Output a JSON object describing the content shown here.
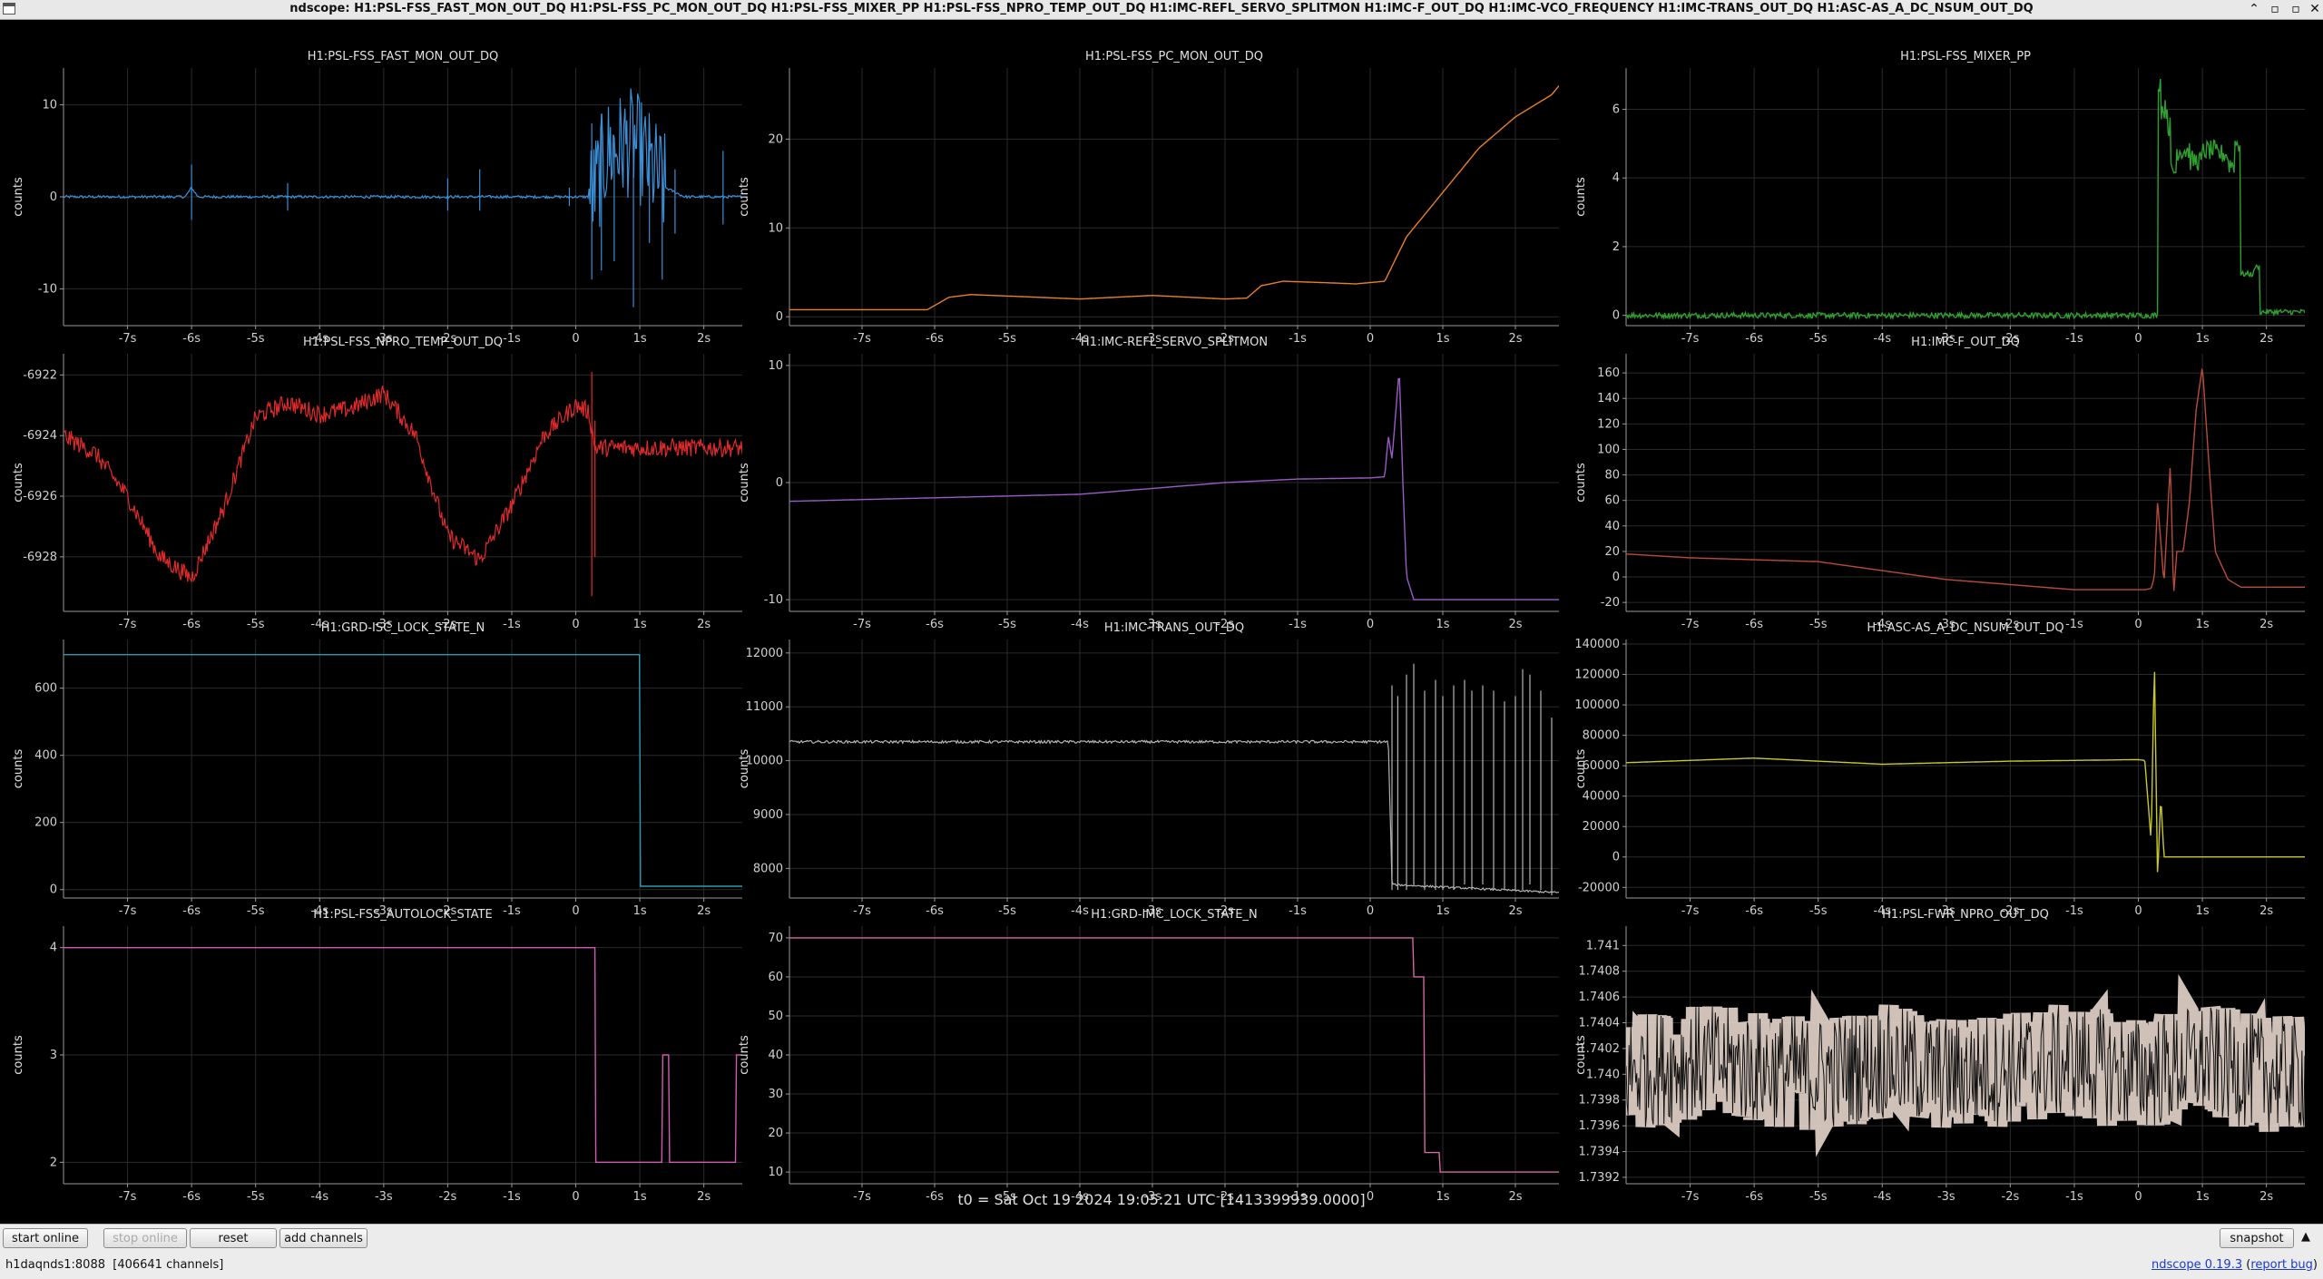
{
  "window": {
    "title": "ndscope: H1:PSL-FSS_FAST_MON_OUT_DQ H1:PSL-FSS_PC_MON_OUT_DQ H1:PSL-FSS_MIXER_PP H1:PSL-FSS_NPRO_TEMP_OUT_DQ H1:IMC-REFL_SERVO_SPLITMON H1:IMC-F_OUT_DQ H1:IMC-VCO_FREQUENCY H1:IMC-TRANS_OUT_DQ H1:ASC-AS_A_DC_NSUM_OUT_DQ",
    "controls": {
      "minimize": "⌃",
      "maximize": "▫",
      "restore": "▫",
      "close": "✕"
    }
  },
  "t0_label": "t0 = Sat Oct 19 2024 19:05:21 UTC [1413399939.0000]",
  "toolbar": {
    "start_online": "start online",
    "stop_online": "stop online",
    "reset": "reset",
    "add_channels": "add channels",
    "snapshot": "snapshot",
    "toggle": "▲"
  },
  "status": {
    "server": "h1daqnds1:8088",
    "channels": "[406641 channels]",
    "version_prefix": "ndscope",
    "version": "0.19.3",
    "report_bug": "report bug"
  },
  "chart_data": [
    {
      "type": "line",
      "title": "H1:PSL-FSS_FAST_MON_OUT_DQ",
      "ylabel": "counts",
      "color": "#3a8fd6",
      "style": "noise",
      "xlim": [
        -8,
        2.6
      ],
      "ylim": [
        -14,
        14
      ],
      "yticks": [
        -10,
        0,
        10
      ],
      "x": [
        -8,
        -6.1,
        -6,
        -5.9,
        -5,
        -3,
        -1,
        0,
        0.2,
        0.3,
        0.5,
        0.9,
        1.2,
        1.4,
        1.7,
        2.6
      ],
      "y": [
        0,
        0,
        1,
        0,
        0,
        0,
        0,
        0,
        0,
        1,
        5,
        6,
        3,
        1,
        0,
        0
      ],
      "noise": 0.15,
      "noise_x": [
        0.2,
        1.4
      ],
      "noise_y": 6,
      "spikes": [
        [
          -6,
          3.5,
          -2.5
        ],
        [
          -4.5,
          1.5,
          -1.5
        ],
        [
          -2,
          2,
          -1.5
        ],
        [
          -1.5,
          3,
          -1.5
        ],
        [
          -0.1,
          1,
          -1
        ],
        [
          0.25,
          8,
          -9
        ],
        [
          0.4,
          9,
          -8
        ],
        [
          0.6,
          6,
          -7
        ],
        [
          0.9,
          4,
          -12
        ],
        [
          1.15,
          8,
          -5
        ],
        [
          1.35,
          4,
          -9
        ],
        [
          1.55,
          3,
          -4
        ],
        [
          2.3,
          5,
          -3
        ]
      ]
    },
    {
      "type": "line",
      "title": "H1:PSL-FSS_PC_MON_OUT_DQ",
      "ylabel": "counts",
      "color": "#e8802a",
      "style": "line",
      "xlim": [
        -8,
        2.6
      ],
      "ylim": [
        -1,
        28
      ],
      "yticks": [
        0,
        10,
        20
      ],
      "x": [
        -8,
        -6.1,
        -5.8,
        -5.5,
        -4,
        -3,
        -2.5,
        -2,
        -1.7,
        -1.5,
        -1.2,
        -0.5,
        -0.2,
        0.2,
        0.5,
        1,
        1.5,
        2,
        2.5,
        2.6
      ],
      "y": [
        0.8,
        0.8,
        2.2,
        2.5,
        2,
        2.4,
        2.2,
        2.0,
        2.1,
        3.5,
        4,
        3.8,
        3.7,
        4,
        9,
        14,
        19,
        22.5,
        25,
        26
      ],
      "noise": 0
    },
    {
      "type": "line",
      "title": "H1:PSL-FSS_MIXER_PP",
      "ylabel": "counts",
      "color": "#2ea02e",
      "style": "step",
      "xlim": [
        -8,
        2.6
      ],
      "ylim": [
        -0.3,
        7.2
      ],
      "yticks": [
        0,
        2,
        4,
        6
      ],
      "x": [
        -8,
        0.2,
        0.3,
        0.35,
        0.45,
        0.5,
        0.6,
        0.8,
        1.0,
        1.2,
        1.4,
        1.5,
        1.6,
        1.8,
        1.9,
        2.0,
        2.4,
        2.6
      ],
      "y": [
        0,
        0,
        6.8,
        6,
        5.5,
        4.2,
        4.8,
        4.5,
        4.8,
        4.7,
        4.4,
        5,
        1.2,
        1.4,
        0.1,
        0.1,
        0.1,
        1.3
      ],
      "noise": 0.08,
      "noise_x": [
        0.3,
        1.6
      ],
      "noise_y": 0.3
    },
    {
      "type": "line",
      "title": "H1:PSL-FSS_NPRO_TEMP_OUT_DQ",
      "ylabel": "counts",
      "color": "#e02a2a",
      "style": "noise",
      "xlim": [
        -8,
        2.6
      ],
      "ylim": [
        -6929.8,
        -6921.3
      ],
      "yticks": [
        -6928,
        -6926,
        -6924,
        -6922
      ],
      "x": [
        -8,
        -7.5,
        -7,
        -6.5,
        -6,
        -5.5,
        -5,
        -4.5,
        -4,
        -3.5,
        -3,
        -2.5,
        -2,
        -1.5,
        -1,
        -0.5,
        0,
        0.2,
        0.3,
        0.4,
        0.6,
        1,
        2,
        2.6
      ],
      "y": [
        -6924,
        -6924.6,
        -6926,
        -6928,
        -6928.7,
        -6926.4,
        -6923.4,
        -6922.9,
        -6923.3,
        -6923.1,
        -6922.6,
        -6924,
        -6927.3,
        -6928.1,
        -6926.3,
        -6924,
        -6923,
        -6923.2,
        -6924.4,
        -6924.4,
        -6924.4,
        -6924.4,
        -6924.4,
        -6924.4
      ],
      "noise": 0.3,
      "noise_x": [
        -8,
        0.25
      ],
      "noise_y": 0.3,
      "spikes": [
        [
          0.25,
          -6921.9,
          -6929.3
        ],
        [
          0.3,
          -6923.5,
          -6928
        ]
      ]
    },
    {
      "type": "line",
      "title": "H1:IMC-REFL_SERVO_SPLITMON",
      "ylabel": "counts",
      "color": "#9a5ac8",
      "style": "line",
      "xlim": [
        -8,
        2.6
      ],
      "ylim": [
        -11,
        11
      ],
      "yticks": [
        -10,
        0,
        10
      ],
      "x": [
        -8,
        -4,
        -2,
        -1,
        0,
        0.2,
        0.25,
        0.3,
        0.4,
        0.45,
        0.5,
        0.6,
        0.7,
        0.8,
        2,
        2.6
      ],
      "y": [
        -1.6,
        -1,
        0,
        0.3,
        0.4,
        0.5,
        4,
        2,
        9.7,
        0,
        -8,
        -10,
        -10,
        -10,
        -10,
        -10
      ],
      "noise": 0
    },
    {
      "type": "line",
      "title": "H1:IMC-F_OUT_DQ",
      "ylabel": "counts",
      "color": "#b84c3a",
      "style": "line",
      "xlim": [
        -8,
        2.6
      ],
      "ylim": [
        -27,
        175
      ],
      "yticks": [
        -20,
        0,
        20,
        40,
        60,
        80,
        100,
        120,
        140,
        160
      ],
      "x": [
        -8,
        -7,
        -5,
        -3,
        -2,
        -1,
        0,
        0.1,
        0.2,
        0.25,
        0.3,
        0.4,
        0.5,
        0.55,
        0.6,
        0.7,
        0.8,
        0.9,
        1,
        1.1,
        1.2,
        1.4,
        1.6,
        2,
        2.6
      ],
      "y": [
        18,
        15,
        12,
        -2,
        -6,
        -10,
        -10,
        -10,
        -9,
        0,
        60,
        -5,
        90,
        -15,
        20,
        20,
        60,
        130,
        165,
        90,
        20,
        -2,
        -8,
        -8,
        -8
      ],
      "noise": 0
    },
    {
      "type": "line",
      "title": "H1:GRD-ISC_LOCK_STATE_N",
      "ylabel": "counts",
      "color": "#2a9ab4",
      "style": "step",
      "xlim": [
        -8,
        2.6
      ],
      "ylim": [
        -25,
        745
      ],
      "yticks": [
        0,
        200,
        400,
        600
      ],
      "x": [
        -8,
        0.9,
        1.0,
        1.05,
        1.3,
        2.6
      ],
      "y": [
        700,
        700,
        10,
        10,
        10,
        12
      ],
      "noise": 0
    },
    {
      "type": "line",
      "title": "H1:IMC-TRANS_OUT_DQ",
      "ylabel": "counts",
      "color": "#b4b4b4",
      "style": "noise",
      "xlim": [
        -8,
        2.6
      ],
      "ylim": [
        7450,
        12250
      ],
      "yticks": [
        8000,
        9000,
        10000,
        11000,
        12000
      ],
      "x": [
        -8,
        0.25,
        0.3,
        2.6
      ],
      "y": [
        10350,
        10350,
        7700,
        7550
      ],
      "noise": 18,
      "noise_x": [
        -8,
        0.25
      ],
      "noise_y": 25,
      "spikes": [
        [
          0.3,
          11400,
          7600
        ],
        [
          0.38,
          11200,
          7600
        ],
        [
          0.5,
          11600,
          7600
        ],
        [
          0.6,
          11800,
          7700
        ],
        [
          0.75,
          11300,
          7600
        ],
        [
          0.9,
          11500,
          7600
        ],
        [
          1.0,
          11200,
          7600
        ],
        [
          1.15,
          11400,
          7600
        ],
        [
          1.3,
          11500,
          7700
        ],
        [
          1.4,
          11300,
          7600
        ],
        [
          1.55,
          11400,
          7700
        ],
        [
          1.7,
          11300,
          7600
        ],
        [
          1.85,
          11100,
          7600
        ],
        [
          2.0,
          11200,
          7600
        ],
        [
          2.1,
          11700,
          7600
        ],
        [
          2.2,
          11600,
          7700
        ],
        [
          2.35,
          11300,
          7600
        ],
        [
          2.5,
          10800,
          7500
        ]
      ]
    },
    {
      "type": "line",
      "title": "H1:ASC-AS_A_DC_NSUM_OUT_DQ",
      "ylabel": "counts",
      "color": "#c8c82a",
      "style": "line",
      "xlim": [
        -8,
        2.6
      ],
      "ylim": [
        -27000,
        143000
      ],
      "yticks": [
        -20000,
        0,
        20000,
        40000,
        60000,
        80000,
        100000,
        120000,
        140000
      ],
      "x": [
        -8,
        -6,
        -4,
        -2,
        0,
        0.1,
        0.2,
        0.25,
        0.3,
        0.35,
        0.4,
        0.5,
        1,
        2,
        2.6
      ],
      "y": [
        62000,
        65000,
        61000,
        63000,
        64000,
        63500,
        10000,
        130000,
        -15000,
        40000,
        0,
        0,
        0,
        0,
        0
      ],
      "noise": 0
    },
    {
      "type": "line",
      "title": "H1:PSL-FSS_AUTOLOCK_STATE",
      "ylabel": "counts",
      "color": "#d05ab4",
      "style": "step",
      "xlim": [
        -8,
        2.6
      ],
      "ylim": [
        1.8,
        4.2
      ],
      "yticks": [
        2,
        3,
        4
      ],
      "x": [
        -8,
        0.2,
        0.3,
        1.3,
        1.35,
        1.45,
        2.3,
        2.5,
        2.6
      ],
      "y": [
        4,
        4,
        2,
        2,
        3,
        2,
        2,
        3,
        3
      ],
      "noise": 0
    },
    {
      "type": "line",
      "title": "H1:GRD-IMC_LOCK_STATE_N",
      "ylabel": "counts",
      "color": "#d06aa0",
      "style": "step",
      "xlim": [
        -8,
        2.6
      ],
      "ylim": [
        7,
        73
      ],
      "yticks": [
        10,
        20,
        30,
        40,
        50,
        60,
        70
      ],
      "x": [
        -8,
        0.5,
        0.6,
        0.7,
        0.75,
        0.85,
        0.95,
        1,
        2.6
      ],
      "y": [
        70,
        70,
        60,
        60,
        15,
        15,
        10,
        10,
        10
      ],
      "noise": 0
    },
    {
      "type": "line",
      "title": "H1:PSL-FWR_NPRO_OUT_DQ",
      "ylabel": "counts",
      "color": "#e6d6cc",
      "style": "band",
      "xlim": [
        -8,
        2.6
      ],
      "ylim": [
        1.73915,
        1.74115
      ],
      "yticks": [
        1.7392,
        1.7394,
        1.7396,
        1.7398,
        1.74,
        1.7402,
        1.7404,
        1.7406,
        1.7408,
        1.741
      ],
      "ytick_labels": [
        "1.7392",
        "1.7394",
        "1.7396",
        "1.7398",
        "1.740",
        "1.7402",
        "1.7404",
        "1.7406",
        "1.7408",
        "1.741"
      ],
      "x": [
        -8,
        -7,
        -6,
        -5,
        -4,
        -3,
        -2,
        -1,
        0,
        1,
        2,
        2.6
      ],
      "y": [
        1.74,
        1.7401,
        1.74005,
        1.74,
        1.7401,
        1.74,
        1.74005,
        1.7401,
        1.74,
        1.7401,
        1.74,
        1.74
      ],
      "noise": 0.00045,
      "noise_x": [
        -8,
        2.6
      ],
      "noise_y": 0.00045
    }
  ],
  "xtick_labels": [
    "-7s",
    "-6s",
    "-5s",
    "-4s",
    "-3s",
    "-2s",
    "-1s",
    "0",
    "1s",
    "2s"
  ]
}
